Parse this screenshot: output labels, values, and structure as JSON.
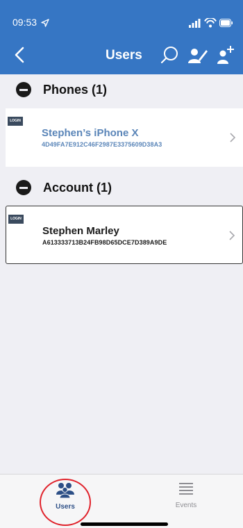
{
  "status_bar": {
    "time": "09:53"
  },
  "header": {
    "title": "Users"
  },
  "sections": [
    {
      "label": "Phones (1)",
      "items": [
        {
          "badge": "LOGIN",
          "name": "Stephen’s iPhone X",
          "id": "4D49FA7E912C46F2987E3375609D38A3",
          "color": "#5a85b8"
        }
      ]
    },
    {
      "label": "Account (1)",
      "items": [
        {
          "badge": "LOGIN",
          "name": "Stephen Marley",
          "id": "A613333713B24FB98D65DCE7D389A9DE",
          "color": "#1a1a1a"
        }
      ]
    }
  ],
  "tabs": [
    {
      "label": "Users",
      "icon": "users-icon",
      "active": true
    },
    {
      "label": "Events",
      "icon": "list-icon",
      "active": false
    }
  ],
  "colors": {
    "header_bg": "#3676c4",
    "annotation": "#e0222b"
  }
}
